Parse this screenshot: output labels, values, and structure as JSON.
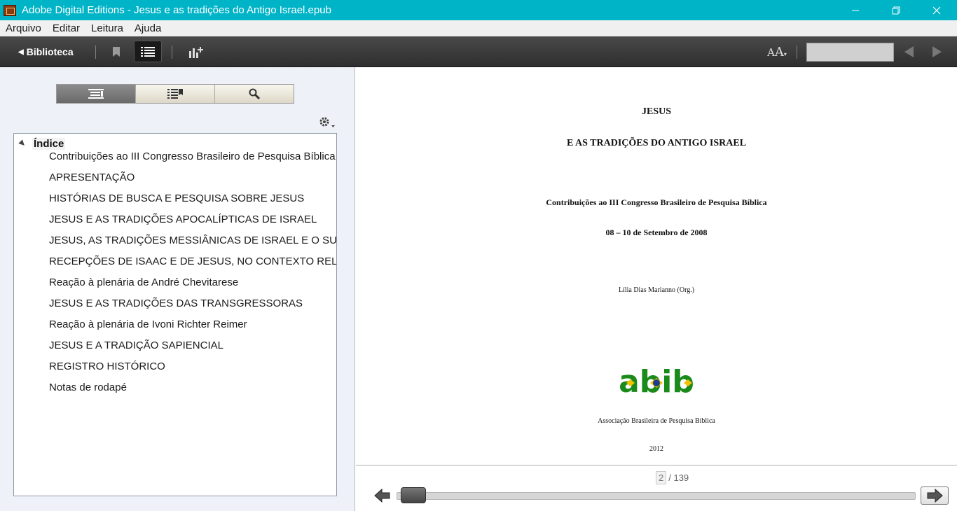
{
  "window": {
    "title": "Adobe Digital Editions - Jesus e as tradições do Antigo Israel.epub"
  },
  "menu": [
    "Arquivo",
    "Editar",
    "Leitura",
    "Ajuda"
  ],
  "toolbar": {
    "library_label": "Biblioteca"
  },
  "panel": {
    "toc_root": "Índice",
    "toc_items": [
      "Contribuições ao III Congresso Brasileiro de Pesquisa Bíblica",
      "APRESENTAÇÃO",
      "HISTÓRIAS DE BUSCA E PESQUISA SOBRE JESUS",
      "JESUS E AS TRADIÇÕES APOCALÍPTICAS DE ISRAEL",
      "JESUS, AS TRADIÇÕES MESSIÂNICAS DE ISRAEL E O SUBMUNI",
      "RECEPÇÕES DE ISAAC E DE JESUS, NO CONTEXTO RELIGIOSO",
      "Reação à plenária de André Chevitarese",
      "JESUS E AS TRADIÇÕES DAS TRANSGRESSORAS",
      "Reação à plenária de Ivoni Richter Reimer",
      "JESUS E A TRADIÇÃO SAPIENCIAL",
      "REGISTRO HISTÓRICO",
      "Notas de rodapé"
    ]
  },
  "page": {
    "title": "JESUS",
    "subtitle": "E AS TRADIÇÕES DO ANTIGO ISRAEL",
    "congress": "Contribuições ao III Congresso Brasileiro de Pesquisa Bíblica",
    "dates": "08 – 10 de Setembro de 2008",
    "editor": "Lília Dias Marianno (Org.)",
    "logo_text": "abib",
    "association": "Associação Brasileira de Pesquisa Bíblica",
    "year": "2012"
  },
  "navigation": {
    "current_page": "2",
    "total_pages": "/ 139"
  },
  "colors": {
    "titlebar": "#00b4c8",
    "logo_green": "#1a8a1a",
    "logo_yellow": "#f2c200",
    "logo_blue": "#1f3c8c"
  }
}
